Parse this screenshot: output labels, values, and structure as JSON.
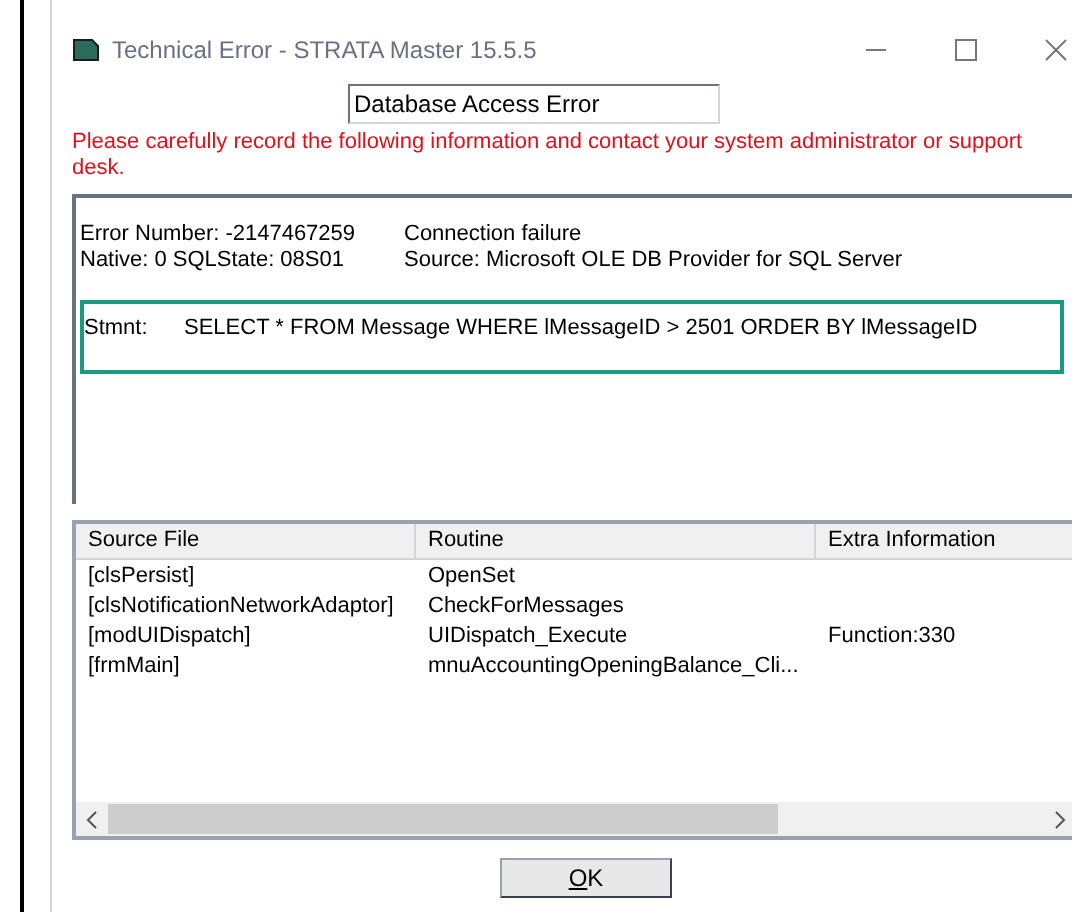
{
  "window": {
    "title": "Technical Error - STRATA Master 15.5.5"
  },
  "error_title": "Database Access Error",
  "instruction": "Please carefully record the following information and contact your system administrator or support desk.",
  "details": {
    "error_number_label": "Error Number:",
    "error_number": "-2147467259",
    "description": "Connection failure",
    "native_label": "Native:",
    "native": "0",
    "sqlstate_label": "SQLState:",
    "sqlstate": "08S01",
    "source": "Source: Microsoft OLE DB Provider for SQL Server",
    "statement_label": "Stmnt:",
    "statement": "SELECT * FROM Message WHERE lMessageID > 2501 ORDER BY lMessageID"
  },
  "table": {
    "columns": [
      "Source File",
      "Routine",
      "Extra Information"
    ],
    "rows": [
      [
        "[clsPersist]",
        "OpenSet",
        ""
      ],
      [
        "[clsNotificationNetworkAdaptor]",
        "CheckForMessages",
        ""
      ],
      [
        "[modUIDispatch]",
        "UIDispatch_Execute",
        "Function:330"
      ],
      [
        "[frmMain]",
        "mnuAccountingOpeningBalance_Cli...",
        ""
      ]
    ]
  },
  "buttons": [
    "OK"
  ]
}
